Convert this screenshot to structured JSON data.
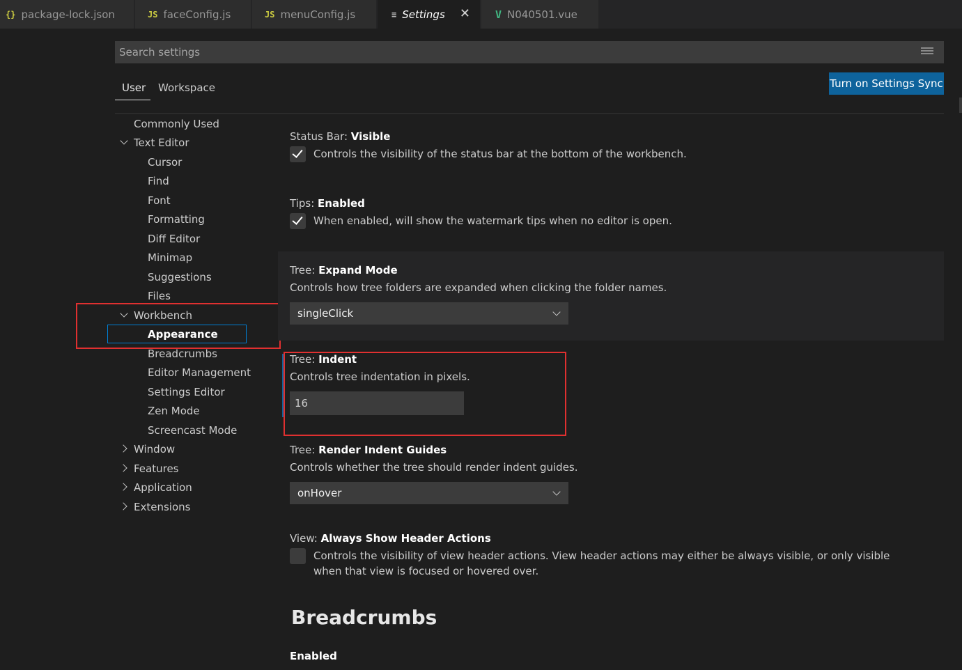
{
  "tabs": [
    {
      "icon": "{}",
      "icon_color": "#cbcb41",
      "label": "package-lock.json"
    },
    {
      "icon": "JS",
      "icon_color": "#cbcb41",
      "label": "faceConfig.js"
    },
    {
      "icon": "JS",
      "icon_color": "#cbcb41",
      "label": "menuConfig.js"
    },
    {
      "icon": "≡",
      "icon_color": "#cccccc",
      "label": "Settings",
      "active": true,
      "close": "✕"
    },
    {
      "icon": "V",
      "icon_color": "#41b883",
      "label": "N040501.vue"
    }
  ],
  "search": {
    "placeholder": "Search settings",
    "icon": "filter-icon"
  },
  "scope": {
    "user": "User",
    "workspace": "Workspace"
  },
  "sync_button": "Turn on Settings Sync",
  "toc": {
    "commonly_used": "Commonly Used",
    "text_editor": "Text Editor",
    "text_editor_children": [
      "Cursor",
      "Find",
      "Font",
      "Formatting",
      "Diff Editor",
      "Minimap",
      "Suggestions",
      "Files"
    ],
    "workbench": "Workbench",
    "workbench_children": [
      "Appearance",
      "Breadcrumbs",
      "Editor Management",
      "Settings Editor",
      "Zen Mode",
      "Screencast Mode"
    ],
    "collapsed": [
      "Window",
      "Features",
      "Application",
      "Extensions"
    ]
  },
  "settings": {
    "status_bar": {
      "category": "Status Bar: ",
      "key": "Visible",
      "desc": "Controls the visibility of the status bar at the bottom of the workbench.",
      "checked": true
    },
    "tips": {
      "category": "Tips: ",
      "key": "Enabled",
      "desc": "When enabled, will show the watermark tips when no editor is open.",
      "checked": true
    },
    "expand_mode": {
      "category": "Tree: ",
      "key": "Expand Mode",
      "desc": "Controls how tree folders are expanded when clicking the folder names.",
      "value": "singleClick"
    },
    "indent": {
      "category": "Tree: ",
      "key": "Indent",
      "desc": "Controls tree indentation in pixels.",
      "value": "16"
    },
    "indent_guides": {
      "category": "Tree: ",
      "key": "Render Indent Guides",
      "desc": "Controls whether the tree should render indent guides.",
      "value": "onHover"
    },
    "header_actions": {
      "category": "View: ",
      "key": "Always Show Header Actions",
      "desc": "Controls the visibility of view header actions. View header actions may either be always visible, or only visible when that view is focused or hovered over.",
      "checked": false
    }
  },
  "breadcrumbs_group": {
    "title": "Breadcrumbs",
    "first_key": "Enabled"
  },
  "colors": {
    "accent": "#0e639c",
    "highlight_border": "#e03030",
    "focus_border": "#007fd4"
  }
}
